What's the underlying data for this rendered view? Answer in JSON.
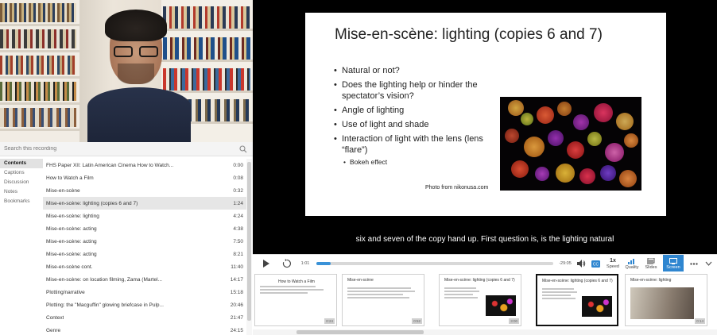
{
  "search": {
    "placeholder": "Search this recording"
  },
  "nav": {
    "items": [
      {
        "label": "Contents",
        "active": true
      },
      {
        "label": "Captions"
      },
      {
        "label": "Discussion"
      },
      {
        "label": "Notes"
      },
      {
        "label": "Bookmarks"
      }
    ]
  },
  "contents": [
    {
      "title": "FHS Paper XII: Latin American Cinema How to Watch...",
      "time": "0:00"
    },
    {
      "title": "How to Watch a Film",
      "time": "0:08"
    },
    {
      "title": "Mise-en-scène",
      "time": "0:32"
    },
    {
      "title": "Mise-en-scène: lighting (copies 6 and 7)",
      "time": "1:24",
      "selected": true
    },
    {
      "title": "Mise-en-scène: lighting",
      "time": "4:24"
    },
    {
      "title": "Mise-en-scène: acting",
      "time": "4:38"
    },
    {
      "title": "Mise-en-scène: acting",
      "time": "7:50"
    },
    {
      "title": "Mise-en-scène: acting",
      "time": "8:21"
    },
    {
      "title": "Mise-en-scène cont.",
      "time": "11:40"
    },
    {
      "title": "Mise-en-scène: on location filming, Zama (Martel...",
      "time": "14:17"
    },
    {
      "title": "Plotting/narrative",
      "time": "15:18"
    },
    {
      "title": "Plotting: the \"Macguffin\" glowing briefcase in Pulp...",
      "time": "20:46"
    },
    {
      "title": "Context",
      "time": "21:47"
    },
    {
      "title": "Genre",
      "time": "24:15"
    }
  ],
  "slide": {
    "title": "Mise-en-scène: lighting (copies 6 and 7)",
    "bullets": [
      "Natural or not?",
      "Does the lighting help or hinder the spectator’s vision?",
      "Angle of lighting",
      "Use of light and shade",
      "Interaction of light with the lens (lens “flare”)"
    ],
    "sub_bullet": "Bokeh effect",
    "photo_credit": "Photo from nikonusa.com"
  },
  "caption": "six and seven of the copy hand up. First question is, is the lighting natural",
  "player": {
    "rewind_seconds": "10",
    "elapsed": "1:01",
    "remaining": "-29:05",
    "progress": 0.06,
    "speed": "1x",
    "speed_label": "Speed",
    "quality_label": "Quality",
    "slides_label": "Slides",
    "screen_label": "Screen",
    "play_icon": "play-icon",
    "cc_label": "CC"
  },
  "thumbnails": [
    {
      "title": "How to Watch a Film",
      "duration": "0:24",
      "active": false
    },
    {
      "title": "Mise-en-scène",
      "duration": "0:52",
      "active": false
    },
    {
      "title": "Mise-en-scène: lighting (copies 6 and 7)",
      "duration": "3:00",
      "active": false
    },
    {
      "title": "Mise-en-scène: lighting (copies 6 and 7)",
      "duration": "",
      "active": true
    },
    {
      "title": "Mise-en-scène: lighting",
      "duration": "0:14",
      "active": false
    }
  ],
  "colors": {
    "accent": "#2f86d0",
    "progress": "#3a92d8"
  }
}
